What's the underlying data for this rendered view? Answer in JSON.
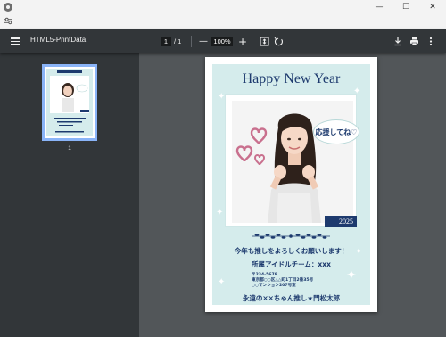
{
  "window": {
    "minimize": "—",
    "maximize": "☐",
    "close": "✕"
  },
  "toolbar": {
    "title": "HTML5-PrintData",
    "current_page": "1",
    "page_separator": "/ 1",
    "zoom": "100%",
    "zoom_out": "—",
    "zoom_in": "+"
  },
  "sidebar": {
    "thumb_number": "1"
  },
  "card": {
    "title": "Happy New Year",
    "bubble": "応援してね♡",
    "year": "2025",
    "message": "今年も推しをよろしくお願いします！",
    "group": "所属アイドルチーム：xxx",
    "address_lines": [
      "〒234-5678",
      "東京都○○区△△町1丁目2番35号",
      "○○マンション207号室"
    ],
    "sender": "永遠の××ちゃん推し★門松太郎"
  },
  "colors": {
    "toolbar_bg": "#323639",
    "viewer_bg": "#525659",
    "card_bg": "#d5ecec",
    "navy": "#1d3a6e",
    "thumb_border": "#8ab4f8"
  }
}
